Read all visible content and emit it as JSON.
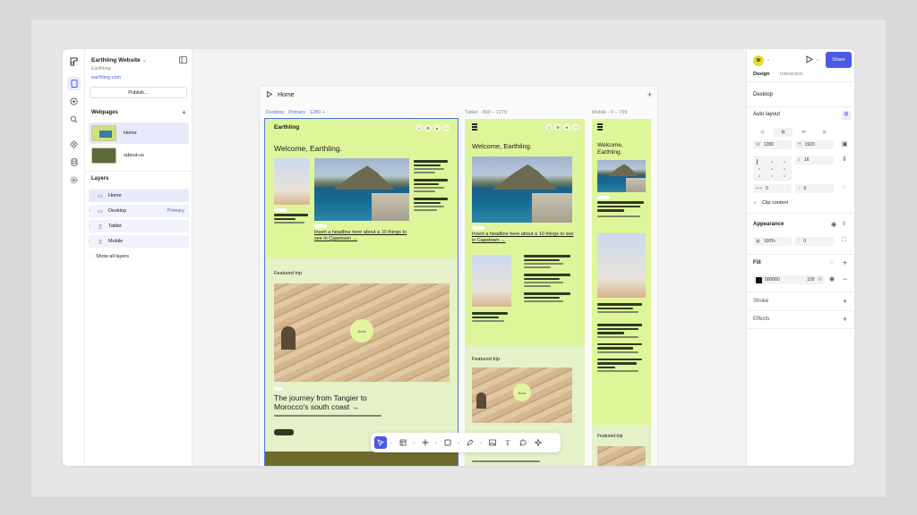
{
  "sidebar": {
    "project_title": "Earthling Website",
    "project_caret": "⌄",
    "team": "Earthling",
    "domain": "earthling.com",
    "publish_label": "Publish...",
    "webpages_heading": "Webpages",
    "pages": [
      {
        "label": "Home"
      },
      {
        "label": "/about-us"
      }
    ],
    "layers_heading": "Layers",
    "layers": [
      {
        "label": "Home"
      },
      {
        "label": "Desktop",
        "tag": "Primary"
      },
      {
        "label": "Tablet"
      },
      {
        "label": "Mobile"
      }
    ],
    "show_all": "Show all layers"
  },
  "canvas": {
    "page_title": "Home",
    "breakpoints": {
      "desktop": "Desktop · Primary · 1280 +",
      "tablet": "Tablet · 800 – 1279",
      "mobile": "Mobile · 0 – 799"
    },
    "site": {
      "logo": "Earthling",
      "welcome": "Welcome, Earthling.",
      "headline": "Insert a headline here about a 10 things to see in Capetown →",
      "featured": "Featured trip",
      "circle": "Book",
      "journey": "The journey from Tangier to Morocco's south coast →"
    }
  },
  "toolbar": {
    "tools": [
      {
        "icon": "cursor-icon"
      },
      {
        "icon": "frame-icon"
      },
      {
        "icon": "component-icon"
      },
      {
        "icon": "rectangle-icon"
      },
      {
        "icon": "pen-icon"
      },
      {
        "icon": "image-icon"
      },
      {
        "icon": "text-icon"
      },
      {
        "icon": "comment-icon"
      },
      {
        "icon": "ai-icon"
      }
    ],
    "text_glyph": "T"
  },
  "props": {
    "avatar_initial": "W",
    "share_label": "Share",
    "tab_design": "Design",
    "tab_interaction": "Interaction",
    "selection": "Desktop",
    "auto_layout": "Auto layout",
    "width_key": "W",
    "width": "1280",
    "height_key": "H",
    "height": "1920",
    "gap": "16",
    "padding_h": "0",
    "padding_v": "0",
    "clip_content": "Clip content",
    "appearance": "Appearance",
    "opacity": "100%",
    "radius": "0",
    "fill": "Fill",
    "fill_hex": "000000",
    "fill_opacity": "100",
    "fill_unit": "%",
    "stroke": "Stroke",
    "effects": "Effects"
  },
  "colors": {
    "accent": "#4b5ae8",
    "lime": "#dff59a",
    "frame_bg": "#e4f1c9"
  }
}
